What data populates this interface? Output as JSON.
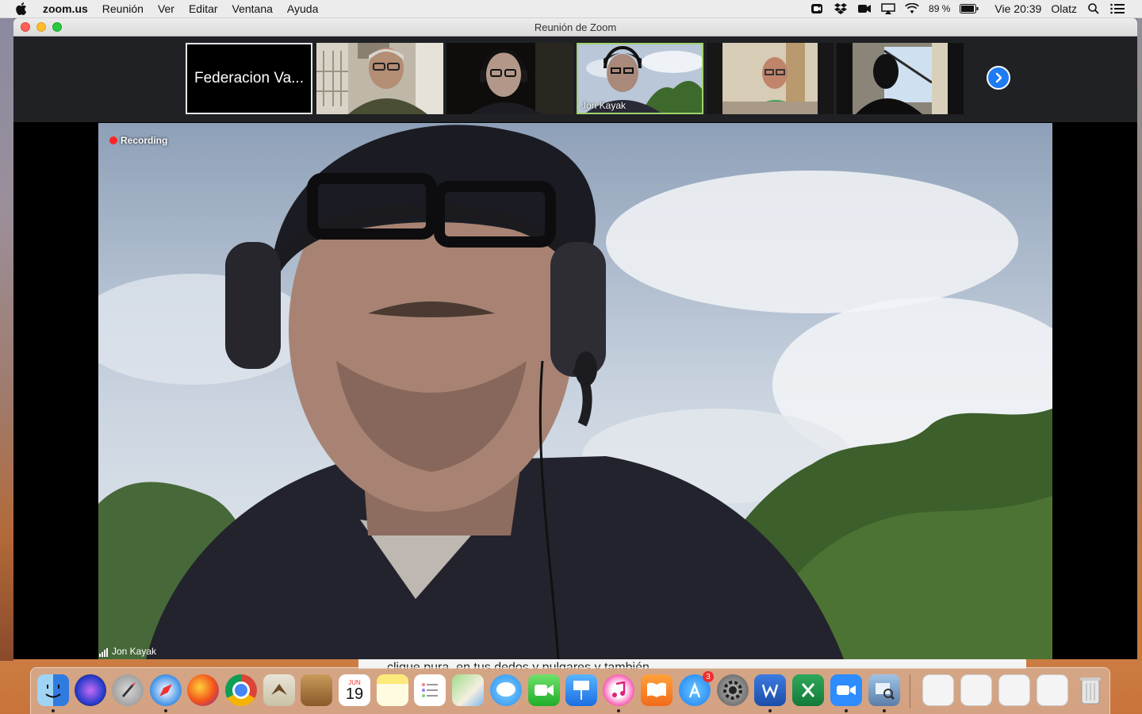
{
  "menubar": {
    "app_name": "zoom.us",
    "menus": [
      "Reunión",
      "Ver",
      "Editar",
      "Ventana",
      "Ayuda"
    ],
    "battery": "89 %",
    "clock": "Vie 20:39",
    "user": "Olatz"
  },
  "window": {
    "title": "Reunión de Zoom"
  },
  "gallery": {
    "name_card": "Federacion Va...",
    "active_participant": "Jon Kayak"
  },
  "main_video": {
    "recording_label": "Recording",
    "speaker_name": "Jon Kayak"
  },
  "background_window": {
    "text": "clique pura, en tus dedos y pulgares y también"
  },
  "dock": {
    "calendar_month": "JUN",
    "calendar_day": "19",
    "appstore_badge": "3"
  }
}
